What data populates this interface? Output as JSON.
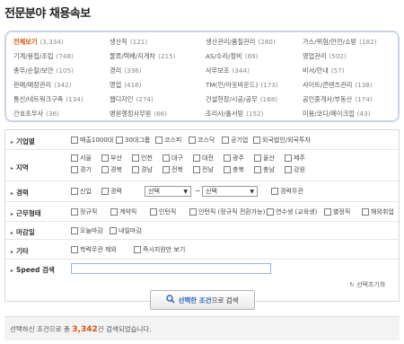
{
  "page": {
    "title": "전문분야 채용속보"
  },
  "categories": [
    {
      "name": "전체보기",
      "count": "(3,334)",
      "active": true
    },
    {
      "name": "생산직",
      "count": "(121)"
    },
    {
      "name": "생산관리/품질관리",
      "count": "(280)"
    },
    {
      "name": "가스/위험/안전/소방",
      "count": "(182)"
    },
    {
      "name": "기계/용접/조립",
      "count": "(748)"
    },
    {
      "name": "물류/택배/지게차",
      "count": "(215)"
    },
    {
      "name": "AS/수리/정비",
      "count": "(69)"
    },
    {
      "name": "영업관리",
      "count": "(502)"
    },
    {
      "name": "총무/순찰/보안",
      "count": "(105)"
    },
    {
      "name": "경리",
      "count": "(336)"
    },
    {
      "name": "사무보조",
      "count": "(344)"
    },
    {
      "name": "비서/안내",
      "count": "(57)"
    },
    {
      "name": "판매/매장관리",
      "count": "(342)"
    },
    {
      "name": "영업",
      "count": "(416)"
    },
    {
      "name": "TM(인/아웃바운드)",
      "count": "(173)"
    },
    {
      "name": "사이트/콘텐츠관리",
      "count": "(138)"
    },
    {
      "name": "통신/네트워크구축",
      "count": "(134)"
    },
    {
      "name": "웹디자인",
      "count": "(274)"
    },
    {
      "name": "건설현장/시공/공무",
      "count": "(168)"
    },
    {
      "name": "공인중개사/부동산",
      "count": "(174)"
    },
    {
      "name": "간호조무사",
      "count": "(36)"
    },
    {
      "name": "병원행정사무원",
      "count": "(66)"
    },
    {
      "name": "조리사/홀서빙",
      "count": "(152)"
    },
    {
      "name": "미용/코디/메이크업",
      "count": "(43)"
    }
  ],
  "filters": {
    "company": {
      "label": "기업별",
      "options": [
        "매출1000대",
        "30대그룹",
        "코스피",
        "코스닥",
        "공기업",
        "외국법인/외국투자"
      ]
    },
    "region": {
      "label": "지역",
      "row1": [
        "서울",
        "부산",
        "인천",
        "대구",
        "대전",
        "광주",
        "울산",
        "제주"
      ],
      "row2": [
        "경기",
        "경북",
        "경남",
        "전북",
        "전남",
        "충북",
        "충남",
        "강원"
      ]
    },
    "career": {
      "label": "경력",
      "options": [
        "신입",
        "경력"
      ],
      "select_from": "선택",
      "select_to": "선택",
      "dash": "~",
      "unrelated": "경력무관"
    },
    "employment": {
      "label": "근무형태",
      "options": [
        "정규직",
        "계약직",
        "인턴직",
        "인턴직 (정규직 전환가능)",
        "연수생 (교육생)",
        "별정직",
        "해외취업"
      ]
    },
    "deadline": {
      "label": "마감일",
      "options": [
        "오늘마감",
        "내일마감"
      ]
    },
    "etc": {
      "label": "기타",
      "options": [
        "학력무관 제외",
        "즉시지원만 보기"
      ]
    },
    "speed": {
      "label": "Speed 검색",
      "placeholder": ""
    }
  },
  "reset_label": "선택초기화",
  "search_button": {
    "highlight": "선택한 조건",
    "rest": "으로 검색"
  },
  "summary": {
    "prefix": "선택하신 조건으로 총 ",
    "count": "3,342",
    "suffix": "건 검색되었습니다."
  }
}
